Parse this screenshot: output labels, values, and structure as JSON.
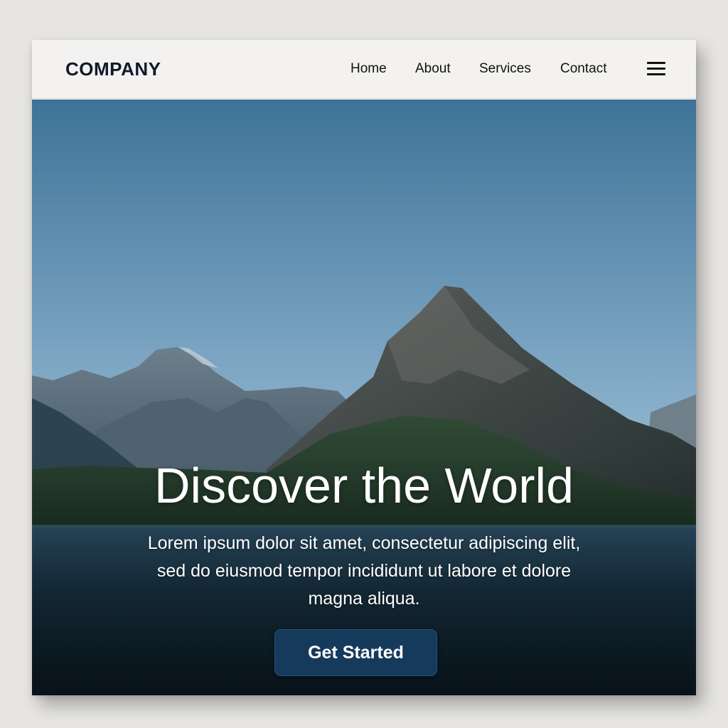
{
  "header": {
    "logo": "COMPANY",
    "nav": {
      "home": "Home",
      "about": "About",
      "services": "Services",
      "contact": "Contact"
    },
    "menu_icon": "hamburger-menu-icon"
  },
  "hero": {
    "title": "Discover the World",
    "description": "Lorem ipsum dolor sit amet, consectetur adipiscing elit, sed do eiusmod tempor incididunt ut labore et dolore magna aliqua.",
    "cta_label": "Get Started",
    "background": "mountain-lake-landscape"
  },
  "colors": {
    "header_bg": "#f3f2f0",
    "logo_text": "#0f1a2b",
    "cta_bg": "#163a5c",
    "sky_top": "#3e7398",
    "sky_bottom": "#93b8d2",
    "water": "#122634"
  }
}
